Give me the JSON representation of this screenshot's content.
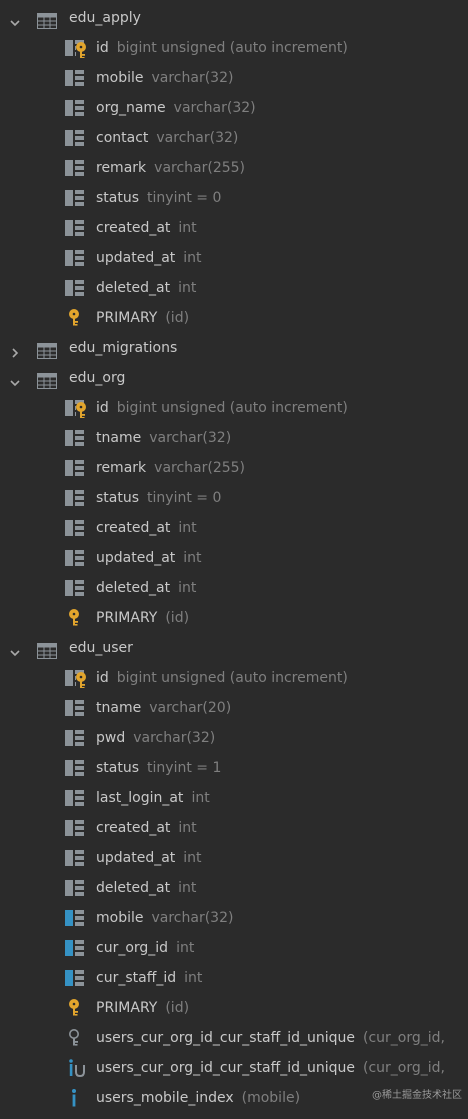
{
  "tables": [
    {
      "name": "edu_apply",
      "expanded": true,
      "items": [
        {
          "kind": "pk",
          "name": "id",
          "type": "bigint unsigned (auto increment)"
        },
        {
          "kind": "col",
          "name": "mobile",
          "type": "varchar(32)"
        },
        {
          "kind": "col",
          "name": "org_name",
          "type": "varchar(32)"
        },
        {
          "kind": "col",
          "name": "contact",
          "type": "varchar(32)"
        },
        {
          "kind": "col",
          "name": "remark",
          "type": "varchar(255)"
        },
        {
          "kind": "col",
          "name": "status",
          "type": "tinyint = 0"
        },
        {
          "kind": "col",
          "name": "created_at",
          "type": "int"
        },
        {
          "kind": "col",
          "name": "updated_at",
          "type": "int"
        },
        {
          "kind": "col",
          "name": "deleted_at",
          "type": "int"
        },
        {
          "kind": "key",
          "name": "PRIMARY",
          "type": "(id)"
        }
      ]
    },
    {
      "name": "edu_migrations",
      "expanded": false,
      "items": []
    },
    {
      "name": "edu_org",
      "expanded": true,
      "items": [
        {
          "kind": "pk",
          "name": "id",
          "type": "bigint unsigned (auto increment)"
        },
        {
          "kind": "col",
          "name": "tname",
          "type": "varchar(32)"
        },
        {
          "kind": "col",
          "name": "remark",
          "type": "varchar(255)"
        },
        {
          "kind": "col",
          "name": "status",
          "type": "tinyint = 0"
        },
        {
          "kind": "col",
          "name": "created_at",
          "type": "int"
        },
        {
          "kind": "col",
          "name": "updated_at",
          "type": "int"
        },
        {
          "kind": "col",
          "name": "deleted_at",
          "type": "int"
        },
        {
          "kind": "key",
          "name": "PRIMARY",
          "type": "(id)"
        }
      ]
    },
    {
      "name": "edu_user",
      "expanded": true,
      "items": [
        {
          "kind": "pk",
          "name": "id",
          "type": "bigint unsigned (auto increment)"
        },
        {
          "kind": "col",
          "name": "tname",
          "type": "varchar(20)"
        },
        {
          "kind": "col",
          "name": "pwd",
          "type": "varchar(32)"
        },
        {
          "kind": "col",
          "name": "status",
          "type": "tinyint = 1"
        },
        {
          "kind": "col",
          "name": "last_login_at",
          "type": "int"
        },
        {
          "kind": "col",
          "name": "created_at",
          "type": "int"
        },
        {
          "kind": "col",
          "name": "updated_at",
          "type": "int"
        },
        {
          "kind": "col",
          "name": "deleted_at",
          "type": "int"
        },
        {
          "kind": "idxcol",
          "name": "mobile",
          "type": "varchar(32)"
        },
        {
          "kind": "idxcol",
          "name": "cur_org_id",
          "type": "int"
        },
        {
          "kind": "idxcol",
          "name": "cur_staff_id",
          "type": "int"
        },
        {
          "kind": "key",
          "name": "PRIMARY",
          "type": "(id)"
        },
        {
          "kind": "ukey",
          "name": "users_cur_org_id_cur_staff_id_unique",
          "type": "(cur_org_id,"
        },
        {
          "kind": "uindex",
          "name": "users_cur_org_id_cur_staff_id_unique",
          "type": "(cur_org_id,"
        },
        {
          "kind": "index",
          "name": "users_mobile_index",
          "type": "(mobile)"
        }
      ]
    }
  ],
  "watermark": "@稀土掘金技术社区",
  "colors": {
    "background": "#2b2b2b",
    "name": "#c8c8c8",
    "type": "#7f7f7f",
    "icon_gray": "#8c9399",
    "key_gold": "#e2a52d",
    "index_blue": "#3592c4"
  }
}
